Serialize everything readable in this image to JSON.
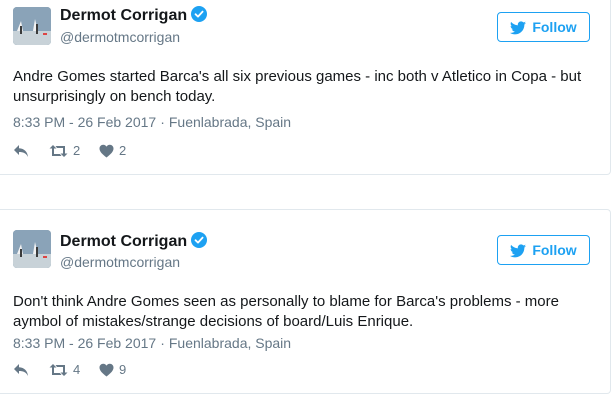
{
  "colors": {
    "twitter_blue": "#1da1f2",
    "name_text": "#14171a",
    "secondary_text": "#657786",
    "border": "#e1e8ed"
  },
  "tweets": [
    {
      "author_name": "Dermot Corrigan",
      "author_handle": "@dermotmcorrigan",
      "verified_icon": "verified-badge-icon",
      "follow_label": "Follow",
      "text": "Andre Gomes started Barca's all six previous games - inc both v Atletico in Copa - but unsurprisingly on bench today.",
      "time": "8:33 PM - 26 Feb 2017",
      "separator": "·",
      "location": "Fuenlabrada, Spain",
      "retweets": "2",
      "likes": "2"
    },
    {
      "author_name": "Dermot Corrigan",
      "author_handle": "@dermotmcorrigan",
      "verified_icon": "verified-badge-icon",
      "follow_label": "Follow",
      "text": "Don't think Andre Gomes seen as personally to blame for Barca's problems - more aymbol of mistakes/strange decisions of board/Luis Enrique.",
      "time": "8:33 PM - 26 Feb 2017",
      "separator": "·",
      "location": "Fuenlabrada, Spain",
      "retweets": "4",
      "likes": "9"
    }
  ]
}
